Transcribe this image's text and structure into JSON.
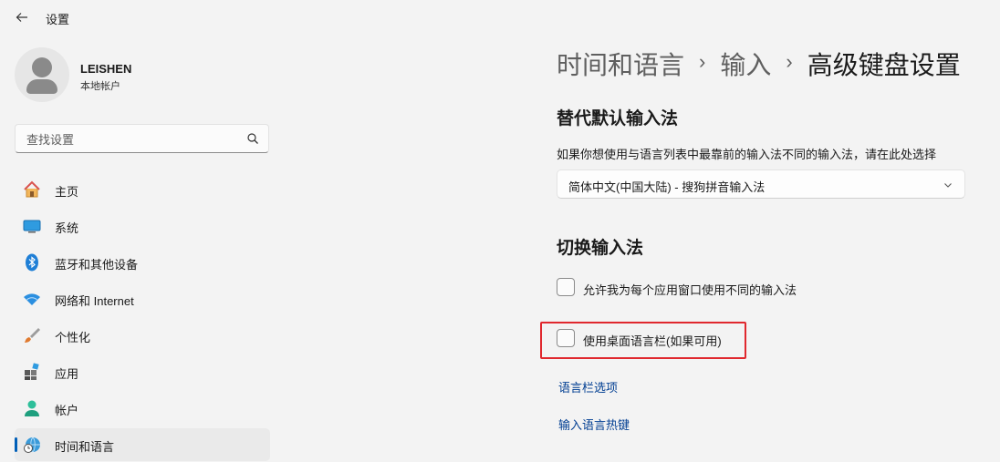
{
  "titlebar": {
    "app_title": "设置"
  },
  "profile": {
    "name": "LEISHEN",
    "account_type": "本地帐户"
  },
  "search": {
    "placeholder": "查找设置"
  },
  "sidebar": {
    "items": [
      {
        "label": "主页",
        "icon": "home-icon"
      },
      {
        "label": "系统",
        "icon": "system-icon"
      },
      {
        "label": "蓝牙和其他设备",
        "icon": "bluetooth-icon"
      },
      {
        "label": "网络和 Internet",
        "icon": "wifi-icon"
      },
      {
        "label": "个性化",
        "icon": "brush-icon"
      },
      {
        "label": "应用",
        "icon": "apps-icon"
      },
      {
        "label": "帐户",
        "icon": "account-icon"
      },
      {
        "label": "时间和语言",
        "icon": "time-language-icon",
        "selected": true
      }
    ]
  },
  "breadcrumb": {
    "level1": "时间和语言",
    "level2": "输入",
    "current": "高级键盘设置",
    "separator": "›"
  },
  "override_section": {
    "title": "替代默认输入法",
    "description": "如果你想使用与语言列表中最靠前的输入法不同的输入法，请在此处选择",
    "selected_value": "简体中文(中国大陆) - 搜狗拼音输入法"
  },
  "switch_section": {
    "title": "切换输入法",
    "checkbox1": {
      "label": "允许我为每个应用窗口使用不同的输入法",
      "checked": false
    },
    "checkbox2": {
      "label": "使用桌面语言栏(如果可用)",
      "checked": false
    }
  },
  "links": {
    "language_bar_options": "语言栏选项",
    "input_language_hotkeys": "输入语言热键"
  },
  "colors": {
    "accent": "#005fb8",
    "highlight": "#e0282e",
    "link": "#003e92",
    "background": "#f3f3f3"
  }
}
